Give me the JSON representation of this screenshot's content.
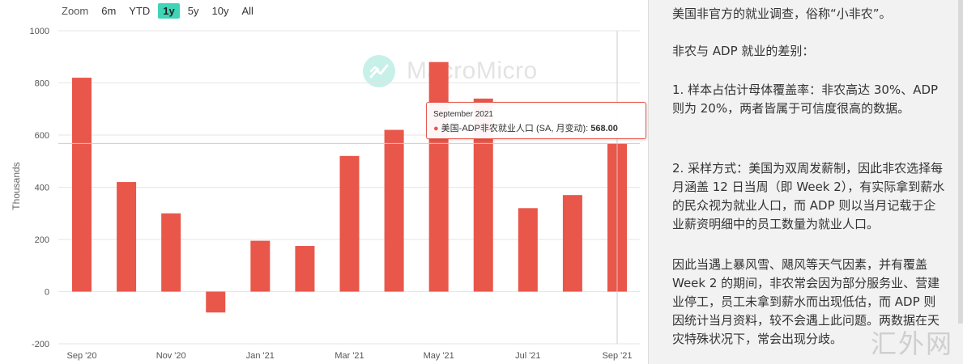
{
  "zoom": {
    "label": "Zoom",
    "options": [
      "6m",
      "YTD",
      "1y",
      "5y",
      "10y",
      "All"
    ],
    "active": "1y"
  },
  "watermark": {
    "text": "MacroMicro"
  },
  "colors": {
    "bar": "#e8574a",
    "accent": "#3fd4b6",
    "grid": "#e6e6e6"
  },
  "chart_data": {
    "type": "bar",
    "ylabel": "Thousands",
    "ylim": [
      -200,
      1000
    ],
    "yticks": [
      -200,
      0,
      200,
      400,
      600,
      800,
      1000
    ],
    "x_tick_labels": [
      "Sep '20",
      "Nov '20",
      "Jan '21",
      "Mar '21",
      "May '21",
      "Jul '21",
      "Sep '21"
    ],
    "categories": [
      "Sep '20",
      "Oct '20",
      "Nov '20",
      "Dec '20",
      "Jan '21",
      "Feb '21",
      "Mar '21",
      "Apr '21",
      "May '21",
      "Jun '21",
      "Jul '21",
      "Aug '21",
      "Sep '21"
    ],
    "series": [
      {
        "name": "美国-ADP非农就业人口 (SA, 月变动)",
        "values": [
          820,
          420,
          300,
          -80,
          195,
          175,
          520,
          620,
          880,
          740,
          320,
          370,
          568
        ]
      }
    ],
    "hover_index": 12,
    "tooltip": {
      "date": "September 2021",
      "series_label": "美国-ADP非农就业人口 (SA, 月变动):",
      "value": "568.00"
    }
  },
  "notes": {
    "p1": "美国非官方的就业调查，俗称“小非农”。",
    "p2": "非农与 ADP 就业的差别：",
    "p3": "1. 样本占估计母体覆盖率：非农高达 30%、ADP 则为 20%，两者皆属于可信度很高的数据。",
    "p4": "2. 采样方式：美国为双周发薪制，因此非农选择每月涵盖 12 日当周（即 Week 2），有实际拿到薪水的民众视为就业人口，而 ADP 则以当月记载于企业薪资明细中的员工数量为就业人口。",
    "p5": "因此当遇上暴风雪、飓风等天气因素，并有覆盖 Week 2 的期间，非农常会因为部分服务业、营建业停工，员工未拿到薪水而出现低估，而 ADP 则因统计当月资料，较不会遇上此问题。两数据在天灾特殊状况下，常会出现分歧。"
  },
  "site_mark": "汇外网"
}
